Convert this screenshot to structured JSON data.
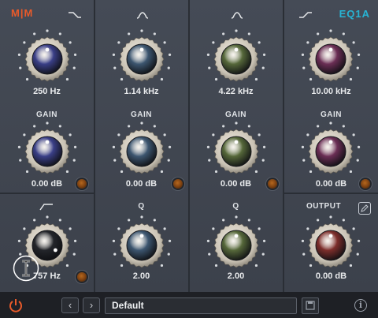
{
  "brand": {
    "left_logo": "M|M",
    "right_logo": "EQ1A"
  },
  "colors": {
    "knob_blue_violet": "#3a3f87",
    "knob_slate_blue": "#3d5670",
    "knob_olive": "#56683a",
    "knob_plum": "#6b2e55",
    "knob_black": "#23252a",
    "knob_red": "#7d2e2b",
    "accent_orange": "#e85a2a",
    "accent_cyan": "#27b3d3"
  },
  "bands": {
    "low_shelf": {
      "freq": "250 Hz",
      "gain_label": "GAIN",
      "gain": "0.00 dB",
      "shape_icon": "low-shelf-icon"
    },
    "low_mid": {
      "freq": "1.14 kHz",
      "gain_label": "GAIN",
      "gain": "0.00 dB",
      "q_label": "Q",
      "q": "2.00",
      "shape_icon": "bell-icon"
    },
    "high_mid": {
      "freq": "4.22 kHz",
      "gain_label": "GAIN",
      "gain": "0.00 dB",
      "q_label": "Q",
      "q": "2.00",
      "shape_icon": "bell-icon"
    },
    "high_shelf": {
      "freq": "10.00 kHz",
      "gain_label": "GAIN",
      "gain": "0.00 dB",
      "shape_icon": "high-shelf-icon"
    },
    "high_pass": {
      "freq": "757 Hz",
      "shape_icon": "high-pass-icon"
    }
  },
  "output": {
    "label": "OUTPUT",
    "value": "0.00 dB"
  },
  "footer": {
    "preset_name": "Default",
    "prev_icon": "chevron-left-icon",
    "next_icon": "chevron-right-icon"
  }
}
